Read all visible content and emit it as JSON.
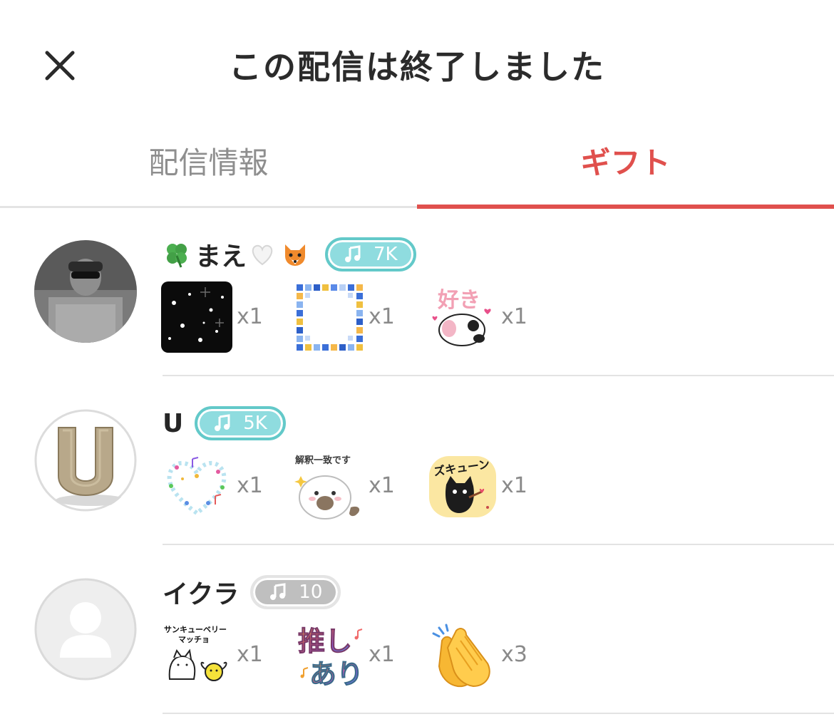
{
  "header": {
    "title": "この配信は終了しました",
    "close_icon": "close-icon"
  },
  "tabs": [
    {
      "label": "配信情報",
      "active": false
    },
    {
      "label": "ギフト",
      "active": true
    }
  ],
  "colors": {
    "accent": "#e0504d",
    "badge_teal": "#8fdcdf",
    "badge_gray": "#bfbfbf"
  },
  "gifters": [
    {
      "name": "まえ",
      "name_emojis": [
        "clover-emoji",
        "white-heart-emoji",
        "fox-emoji"
      ],
      "badge": {
        "icon": "music-note-icon",
        "value": "7K",
        "style": "teal"
      },
      "gifts": [
        {
          "icon": "snow-night-sticker",
          "count": "x1"
        },
        {
          "icon": "pixel-frame-sticker",
          "count": "x1"
        },
        {
          "icon": "panda-suki-sticker",
          "label": "好き",
          "count": "x1"
        }
      ]
    },
    {
      "name": "U",
      "badge": {
        "icon": "music-note-icon",
        "value": "5K",
        "style": "teal"
      },
      "gifts": [
        {
          "icon": "music-heart-sticker",
          "count": "x1"
        },
        {
          "icon": "seal-sticker",
          "label": "解釈一致です",
          "count": "x1"
        },
        {
          "icon": "black-cat-sticker",
          "label": "ズキューン",
          "count": "x1"
        }
      ]
    },
    {
      "name": "イクラ",
      "badge": {
        "icon": "music-note-icon",
        "value": "10",
        "style": "gray"
      },
      "gifts": [
        {
          "icon": "thank-you-cat-sticker",
          "label": "サンキューベリー\nマッチョ",
          "count": "x1"
        },
        {
          "icon": "oshi-ari-sticker",
          "label": "推しあり",
          "count": "x1"
        },
        {
          "icon": "clapping-hands-emoji",
          "count": "x3"
        }
      ]
    }
  ]
}
